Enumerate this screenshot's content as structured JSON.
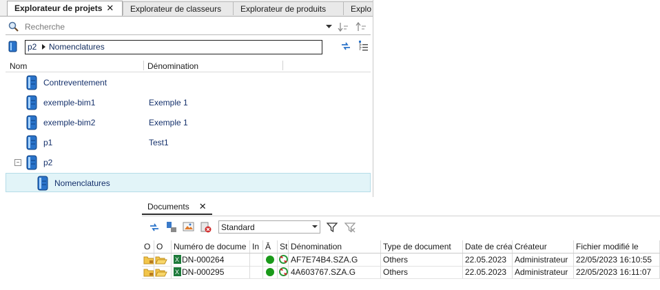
{
  "project_explorer": {
    "tabs": [
      {
        "label": "Explorateur de projets",
        "active": true
      },
      {
        "label": "Explorateur de classeurs",
        "active": false
      },
      {
        "label": "Explorateur de produits",
        "active": false
      },
      {
        "label": "Explo",
        "active": false
      }
    ],
    "search": {
      "placeholder": "Recherche"
    },
    "path": {
      "segments": [
        "p2",
        "Nomenclatures"
      ]
    },
    "columns": {
      "name": "Nom",
      "denomination": "Dénomination"
    },
    "tree": [
      {
        "name": "Contreventement",
        "denomination": ""
      },
      {
        "name": "exemple-bim1",
        "denomination": "Exemple 1"
      },
      {
        "name": "exemple-bim2",
        "denomination": "Exemple 1"
      },
      {
        "name": "p1",
        "denomination": "Test1"
      },
      {
        "name": "p2",
        "denomination": "",
        "expander": "−"
      },
      {
        "name": "Nomenclatures",
        "denomination": "",
        "selected": true
      }
    ]
  },
  "documents": {
    "tab_label": "Documents",
    "view_combo": "Standard",
    "columns": [
      "O",
      "O",
      "Numéro de docume",
      "In",
      "Ā",
      "St",
      "Dénomination",
      "Type de document",
      "Date de créa",
      "Créateur",
      "Fichier modifié le"
    ],
    "rows": [
      {
        "number": "DN-000264",
        "denomination": "AF7E74B4.SZA.G",
        "type": "Others",
        "date": "22.05.2023",
        "creator": "Administrateur",
        "modified": "22/05/2023 16:10:55"
      },
      {
        "number": "DN-000295",
        "denomination": "4A603767.SZA.G",
        "type": "Others",
        "date": "22.05.2023",
        "creator": "Administrateur",
        "modified": "22/05/2023 16:11:07"
      }
    ]
  },
  "colors": {
    "accent": "#1e64c8",
    "tree_text": "#14306b",
    "selection": "#e2f4f8",
    "status_green": "#1a9a1a"
  }
}
